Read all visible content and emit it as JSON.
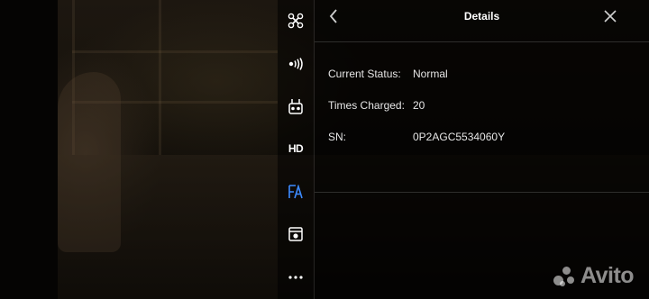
{
  "panel": {
    "title": "Details",
    "rows": [
      {
        "label": "Current Status:",
        "value": "Normal"
      },
      {
        "label": "Times Charged:",
        "value": "20"
      },
      {
        "label": "SN:",
        "value": "0P2AGC5534060Y"
      }
    ]
  },
  "toolbar": {
    "items": [
      {
        "icon": "aircraft-icon"
      },
      {
        "icon": "signal-icon"
      },
      {
        "icon": "remote-controller-icon"
      },
      {
        "icon": "hd-icon",
        "label": "HD"
      },
      {
        "icon": "battery-icon",
        "active": true
      },
      {
        "icon": "camera-settings-icon"
      },
      {
        "icon": "more-icon"
      }
    ],
    "accent_color": "#3d8bff"
  },
  "watermark": {
    "text": "Avito"
  }
}
